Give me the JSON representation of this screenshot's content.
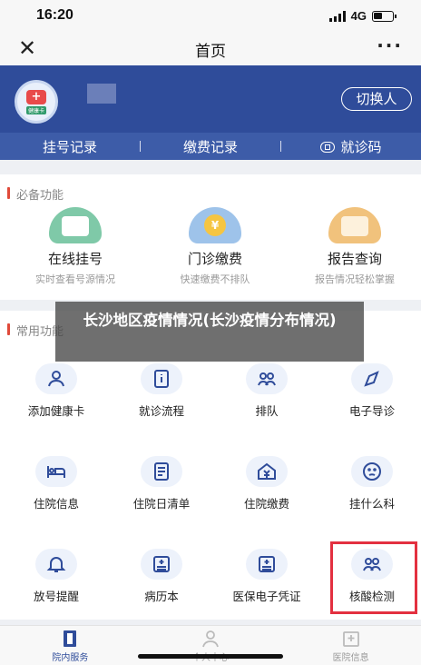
{
  "status": {
    "time": "16:20",
    "network": "4G"
  },
  "nav": {
    "title": "首页"
  },
  "header": {
    "logo_text": "健康卡",
    "switch_label": "切换人",
    "tabs": [
      "挂号记录",
      "缴费记录",
      "就诊码"
    ]
  },
  "essential": {
    "title": "必备功能",
    "items": [
      {
        "label": "在线挂号",
        "sub": "实时查看号源情况",
        "icon": "calendar-icon"
      },
      {
        "label": "门诊缴费",
        "sub": "快速缴费不排队",
        "icon": "yen-coin-icon"
      },
      {
        "label": "报告查询",
        "sub": "报告情况轻松掌握",
        "icon": "report-search-icon"
      }
    ]
  },
  "common": {
    "title": "常用功能",
    "items": [
      {
        "label": "添加健康卡",
        "icon": "user-add-icon"
      },
      {
        "label": "就诊流程",
        "icon": "info-document-icon"
      },
      {
        "label": "排队",
        "icon": "queue-people-icon"
      },
      {
        "label": "电子导诊",
        "icon": "compass-icon"
      },
      {
        "label": "住院信息",
        "icon": "hospital-bed-icon"
      },
      {
        "label": "住院日清单",
        "icon": "daily-list-icon"
      },
      {
        "label": "住院缴费",
        "icon": "yen-house-icon"
      },
      {
        "label": "挂什么科",
        "icon": "question-face-icon"
      },
      {
        "label": "放号提醒",
        "icon": "bell-icon"
      },
      {
        "label": "病历本",
        "icon": "medical-record-icon"
      },
      {
        "label": "医保电子凭证",
        "icon": "insurance-card-icon"
      },
      {
        "label": "核酸检测",
        "icon": "people-test-icon"
      }
    ]
  },
  "overlay": {
    "text": "长沙地区疫情情况(长沙疫情分布情况)"
  },
  "tabbar": {
    "items": [
      "院内服务",
      "个人中心",
      "医院信息"
    ],
    "active_index": 0
  },
  "colors": {
    "primary": "#2f4c9a",
    "highlight": "#e33040"
  }
}
